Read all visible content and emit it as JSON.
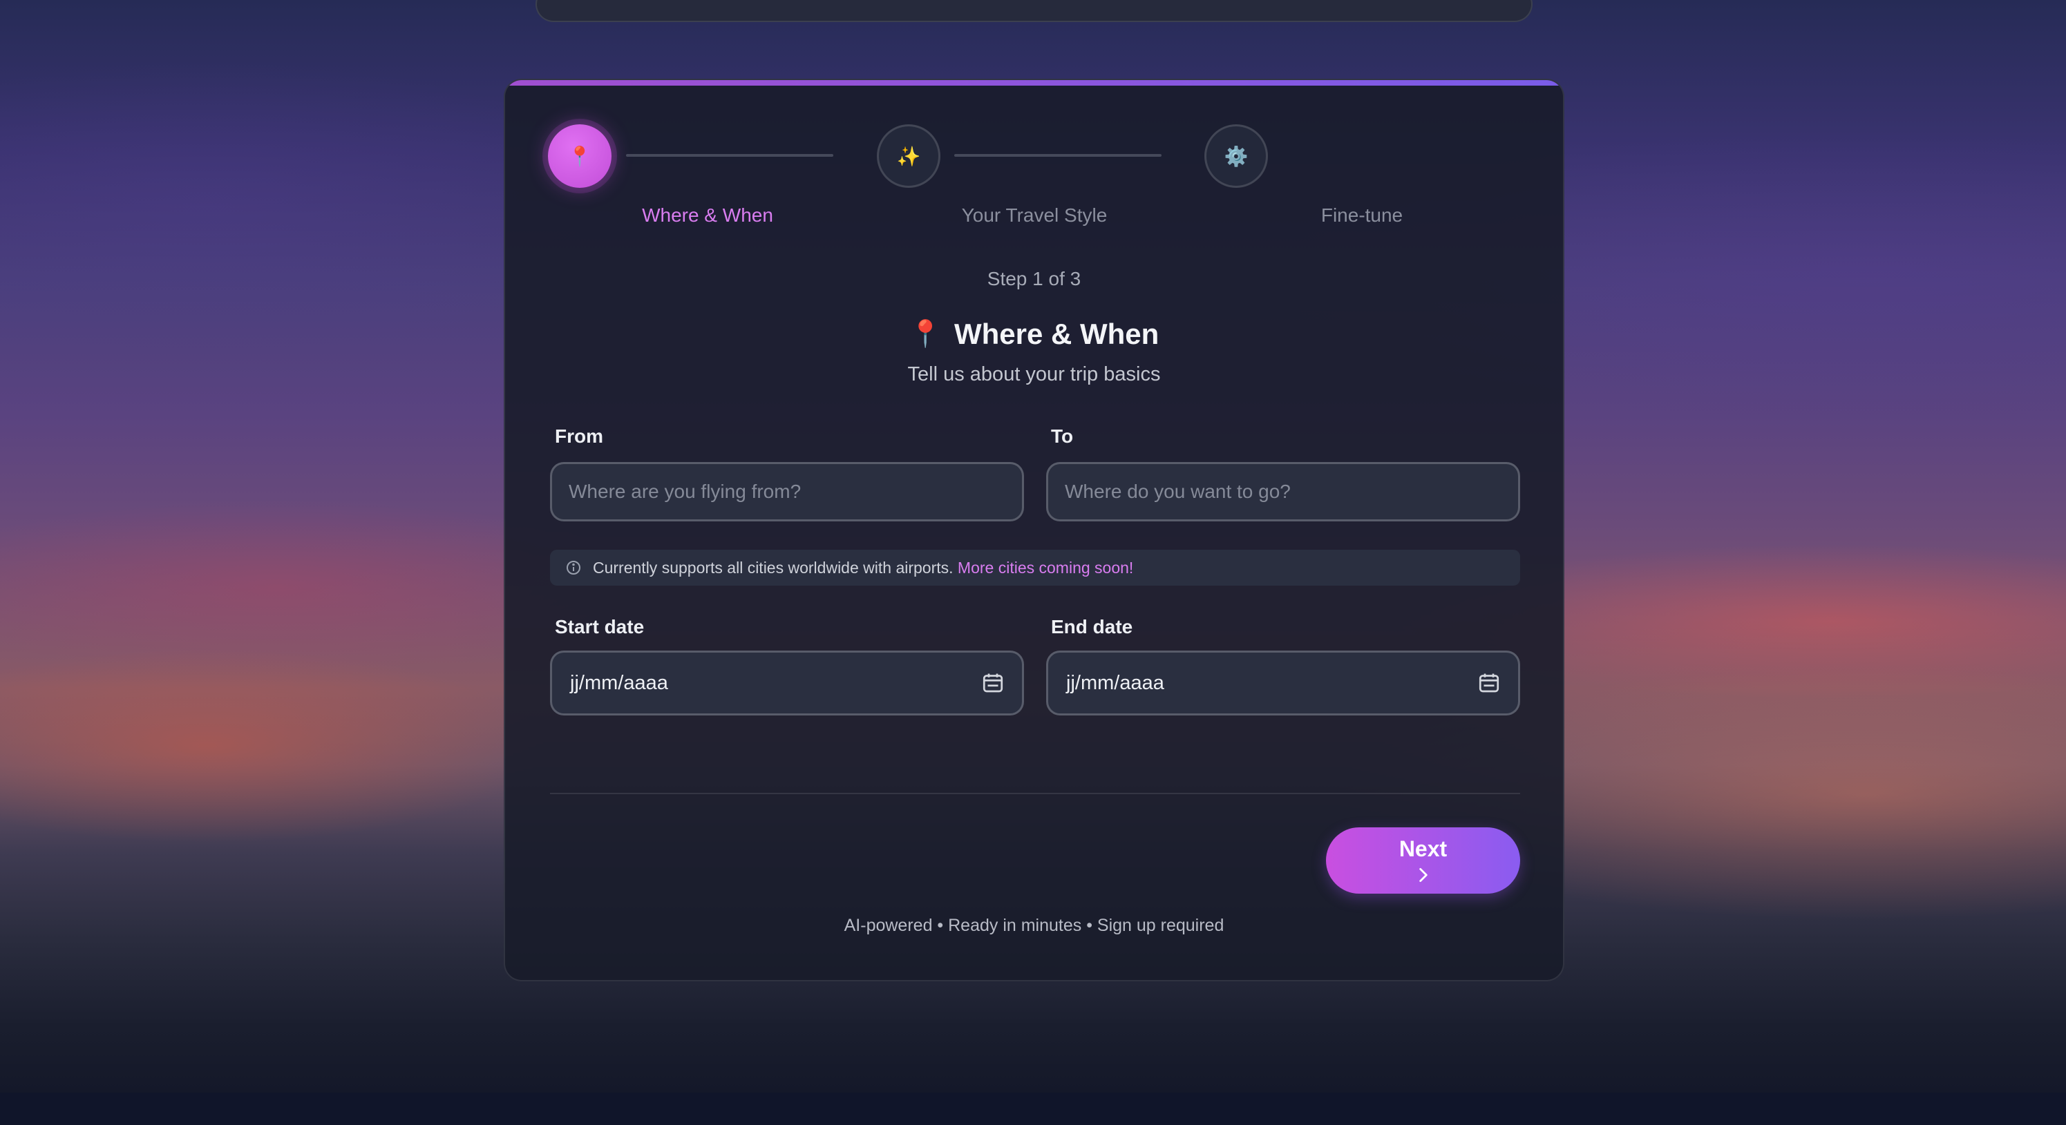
{
  "stepper": {
    "steps": [
      {
        "label": "Where & When",
        "icon": "📍",
        "icon_name": "map-pin-icon",
        "state": "active"
      },
      {
        "label": "Your Travel Style",
        "icon": "✨",
        "icon_name": "sparkles-icon",
        "state": "inactive"
      },
      {
        "label": "Fine-tune",
        "icon": "⚙️",
        "icon_name": "gear-icon",
        "state": "inactive"
      }
    ],
    "progress_text": "Step 1 of 3"
  },
  "section": {
    "icon": "📍",
    "title": "Where & When",
    "subtitle": "Tell us about your trip basics"
  },
  "form": {
    "from_label": "From",
    "from_placeholder": "Where are you flying from?",
    "from_value": "",
    "to_label": "To",
    "to_placeholder": "Where do you want to go?",
    "to_value": "",
    "info_text": "Currently supports all cities worldwide with airports.",
    "info_link": "More cities coming soon!",
    "start_label": "Start date",
    "start_value": "jj/mm/aaaa",
    "end_label": "End date",
    "end_value": "jj/mm/aaaa"
  },
  "actions": {
    "next_label": "Next"
  },
  "footer": {
    "text": "AI-powered • Ready in minutes • Sign up required"
  },
  "colors": {
    "accent": "#d97df0",
    "button_start": "#c94fe0",
    "button_end": "#8a5cf0",
    "card_bg": "#181c2a"
  }
}
